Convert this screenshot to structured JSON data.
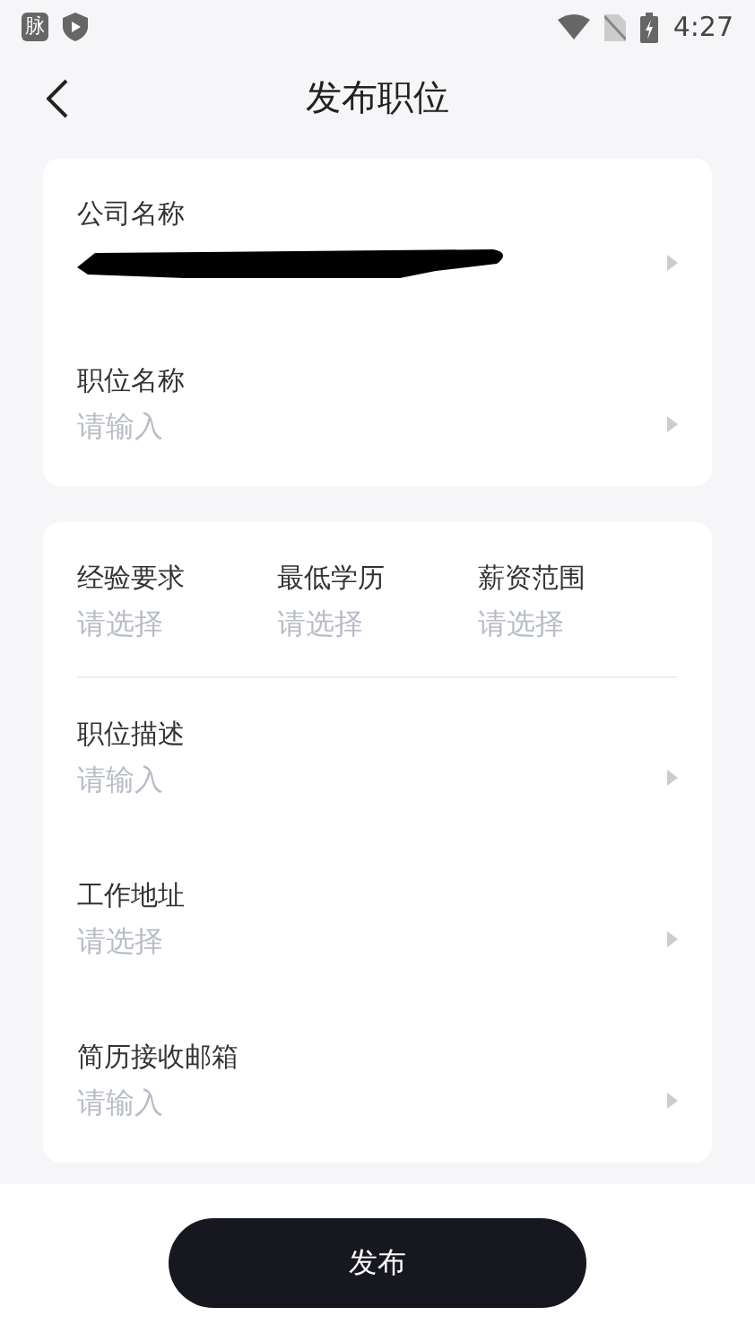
{
  "status_bar": {
    "notifications": [
      {
        "kind": "glyph",
        "text": "脉"
      },
      {
        "kind": "shield"
      }
    ],
    "time": "4:27"
  },
  "header": {
    "title": "发布职位"
  },
  "sections": [
    {
      "rows": [
        {
          "kind": "redacted",
          "label": "公司名称"
        },
        {
          "kind": "field",
          "label": "职位名称",
          "placeholder": "请输入"
        }
      ]
    },
    {
      "rows": [
        {
          "kind": "columns",
          "columns": [
            {
              "label": "经验要求",
              "placeholder": "请选择"
            },
            {
              "label": "最低学历",
              "placeholder": "请选择"
            },
            {
              "label": "薪资范围",
              "placeholder": "请选择"
            }
          ]
        },
        {
          "kind": "field",
          "label": "职位描述",
          "placeholder": "请输入"
        },
        {
          "kind": "field",
          "label": "工作地址",
          "placeholder": "请选择"
        },
        {
          "kind": "field",
          "label": "简历接收邮箱",
          "placeholder": "请输入"
        }
      ]
    }
  ],
  "submit": "发布"
}
